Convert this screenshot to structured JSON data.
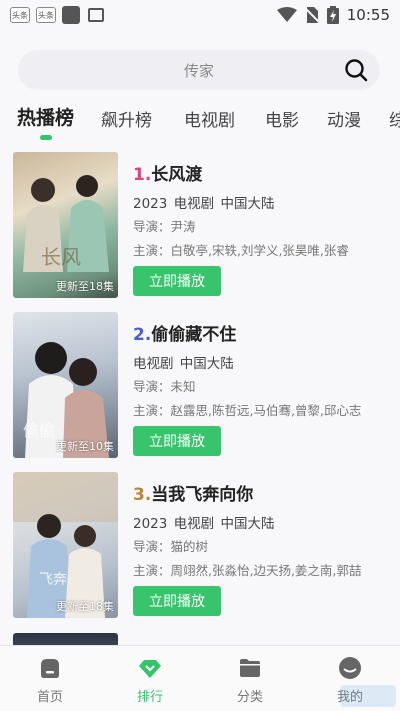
{
  "status_bar": {
    "app1": "头条",
    "app2": "头条",
    "time": "10:55"
  },
  "search": {
    "placeholder": "传家"
  },
  "tabs": [
    {
      "label": "热播榜"
    },
    {
      "label": "飙升榜"
    },
    {
      "label": "电视剧"
    },
    {
      "label": "电影"
    },
    {
      "label": "动漫"
    },
    {
      "label": "综艺"
    }
  ],
  "items": [
    {
      "rank": "1.",
      "rank_color": "#e0407a",
      "title": "长风渡",
      "meta": "2023 电视剧 中国大陆",
      "director": "导演：尹涛",
      "cast": "主演：白敬亭,宋轶,刘学义,张昊唯,张睿",
      "badge": "更新至18集",
      "button": "立即播放"
    },
    {
      "rank": "2.",
      "rank_color": "#4a5bd8",
      "title": "偷偷藏不住",
      "meta": " 电视剧 中国大陆",
      "director": "导演：未知",
      "cast": "主演：赵露思,陈哲远,马伯骞,曾黎,邱心志",
      "badge": "更新至10集",
      "button": "立即播放"
    },
    {
      "rank": "3.",
      "rank_color": "#b8873a",
      "title": "当我飞奔向你",
      "meta": "2023 电视剧 中国大陆",
      "director": "导演：猫的树",
      "cast": "主演：周翊然,张淼怡,边天扬,姜之南,郭喆",
      "badge": "更新至18集",
      "button": "立即播放"
    }
  ],
  "bottom_nav": [
    {
      "label": "首页",
      "icon": "home-icon"
    },
    {
      "label": "排行",
      "icon": "ranking-icon"
    },
    {
      "label": "分类",
      "icon": "folder-icon"
    },
    {
      "label": "我的",
      "icon": "profile-icon"
    }
  ],
  "colors": {
    "accent": "#36c46b",
    "background": "#f8f8fb"
  }
}
